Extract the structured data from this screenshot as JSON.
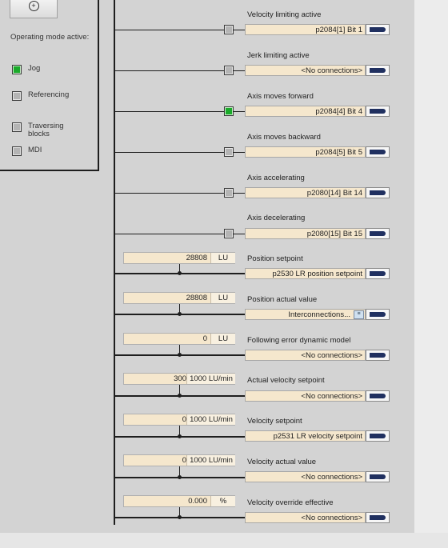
{
  "mode_panel": {
    "title": "Operating mode active:",
    "modes": [
      {
        "label": "Jog",
        "active": true
      },
      {
        "label": "Referencing",
        "active": false
      },
      {
        "label": "Traversing blocks",
        "active": false
      },
      {
        "label": "MDI",
        "active": false
      }
    ]
  },
  "status_signals": [
    {
      "title": "Velocity limiting active",
      "connection": "p2084[1] Bit 1",
      "active": false
    },
    {
      "title": "Jerk limiting active",
      "connection": "<No connections>",
      "active": false
    },
    {
      "title": "Axis moves forward",
      "connection": "p2084[4] Bit 4",
      "active": true
    },
    {
      "title": "Axis moves backward",
      "connection": "p2084[5] Bit 5",
      "active": false
    },
    {
      "title": "Axis accelerating",
      "connection": "p2080[14] Bit 14",
      "active": false
    },
    {
      "title": "Axis decelerating",
      "connection": "p2080[15] Bit 15",
      "active": false
    }
  ],
  "value_signals": [
    {
      "title": "Position setpoint",
      "value": "28808",
      "unit": "LU",
      "connection": "p2530 LR position setpoint"
    },
    {
      "title": "Position actual value",
      "value": "28808",
      "unit": "LU",
      "connection": "Interconnections..."
    },
    {
      "title": "Following error dynamic model",
      "value": "0",
      "unit": "LU",
      "connection": "<No connections>"
    },
    {
      "title": "Actual velocity setpoint",
      "value": "300",
      "unit": "1000 LU/min",
      "connection": "<No connections>"
    },
    {
      "title": "Velocity setpoint",
      "value": "0",
      "unit": "1000 LU/min",
      "connection": "p2531 LR velocity setpoint"
    },
    {
      "title": "Velocity actual value",
      "value": "0",
      "unit": "1000 LU/min",
      "connection": "<No connections>"
    },
    {
      "title": "Velocity override effective",
      "value": "0.000",
      "unit": "%",
      "connection": "<No connections>"
    }
  ],
  "icons": {
    "top_button": "crosshair-icon",
    "connect_button": "connect-arrow-icon",
    "list_icon": "list-icon"
  }
}
